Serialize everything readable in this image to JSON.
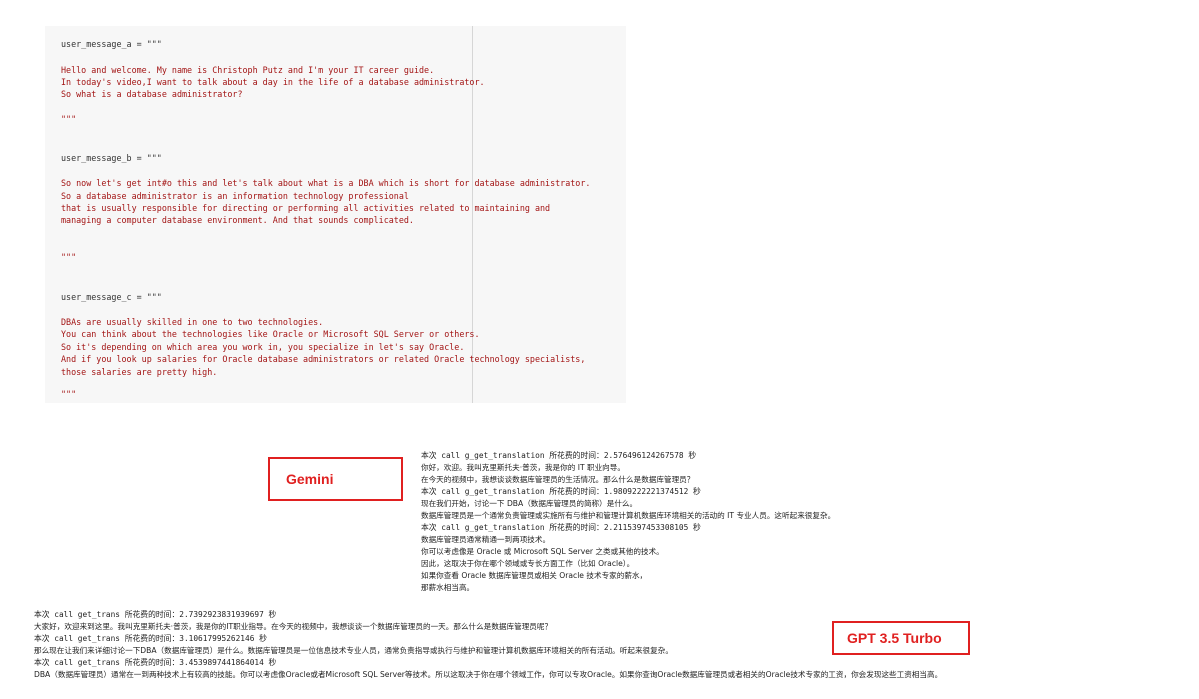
{
  "code": {
    "lines": [
      {
        "t": "user_message_a = \"\"\"",
        "cls": ""
      },
      {
        "t": "Hello and welcome. My name is Christoph Putz and I'm your IT career guide.",
        "cls": "str"
      },
      {
        "t": "In today's video,I want to talk about a day in the life of a database administrator.",
        "cls": "str"
      },
      {
        "t": "So what is a database administrator?",
        "cls": "str"
      },
      {
        "t": "\"\"\"",
        "cls": "str"
      },
      {
        "t": "user_message_b = \"\"\"",
        "cls": ""
      },
      {
        "t": "So now let's get int#o this and let's talk about what is a DBA which is short for database administrator.",
        "cls": "str"
      },
      {
        "t": "So a database administrator is an information technology professional",
        "cls": "str"
      },
      {
        "t": "that is usually responsible for directing or performing all activities related to maintaining and",
        "cls": "str"
      },
      {
        "t": "managing a computer database environment. And that sounds complicated.",
        "cls": "str"
      },
      {
        "t": "\"\"\"",
        "cls": "str"
      },
      {
        "t": "user_message_c = \"\"\"",
        "cls": ""
      },
      {
        "t": "DBAs are usually skilled in one to two technologies.",
        "cls": "str"
      },
      {
        "t": "You can think about the technologies like Oracle or Microsoft SQL Server or others.",
        "cls": "str"
      },
      {
        "t": "So it's depending on which area you work in, you specialize in let's say Oracle.",
        "cls": "str"
      },
      {
        "t": "And if you look up salaries for Oracle database administrators or related Oracle technology specialists,",
        "cls": "str"
      },
      {
        "t": "those salaries are pretty high.",
        "cls": "str"
      },
      {
        "t": "\"\"\"",
        "cls": "str"
      }
    ]
  },
  "gemini": {
    "label": "Gemini",
    "lines": [
      "本次 call g_get_translation 所花费的时间：2.576496124267578 秒",
      "你好，欢迎。我叫克里斯托夫·普茨，我是你的 IT 职业向导。",
      "在今天的视频中，我想谈谈数据库管理员的生活情况。那么什么是数据库管理员？",
      "本次 call g_get_translation 所花费的时间：1.9809222221374512 秒",
      "现在我们开始，讨论一下 DBA（数据库管理员的简称）是什么。",
      "数据库管理员是一个通常负责管理或实施所有与维护和管理计算机数据库环境相关的活动的 IT 专业人员。这听起来很复杂。",
      "本次 call g_get_translation 所花费的时间：2.2115397453308105 秒",
      "数据库管理员通常精通一到两项技术。",
      "你可以考虑像是 Oracle 或 Microsoft SQL Server 之类或其他的技术。",
      "因此，这取决于你在哪个领域或专长方面工作（比如 Oracle）。",
      "如果你查看 Oracle 数据库管理员或相关 Oracle 技术专家的薪水，",
      "那薪水相当高。"
    ]
  },
  "gpt": {
    "label": "GPT 3.5 Turbo",
    "lines": [
      "本次 call get_trans 所花费的时间：2.7392923831939697 秒",
      "大家好，欢迎来到这里。我叫克里斯托夫·普茨，我是你的IT职业指导。在今天的视频中，我想谈谈一个数据库管理员的一天。那么什么是数据库管理员呢？",
      "本次 call get_trans 所花费的时间：3.10617995262146 秒",
      "那么现在让我们来详细讨论一下DBA（数据库管理员）是什么。数据库管理员是一位信息技术专业人员，通常负责指导或执行与维护和管理计算机数据库环境相关的所有活动。听起来很复杂。",
      "本次 call get_trans 所花费的时间：3.4539897441864014 秒",
      "DBA（数据库管理员）通常在一到两种技术上有较高的技能。你可以考虑像Oracle或者Microsoft SQL Server等技术。所以这取决于你在哪个领域工作，你可以专攻Oracle。如果你查询Oracle数据库管理员或者相关的Oracle技术专家的工资，你会发现这些工资相当高。"
    ]
  }
}
